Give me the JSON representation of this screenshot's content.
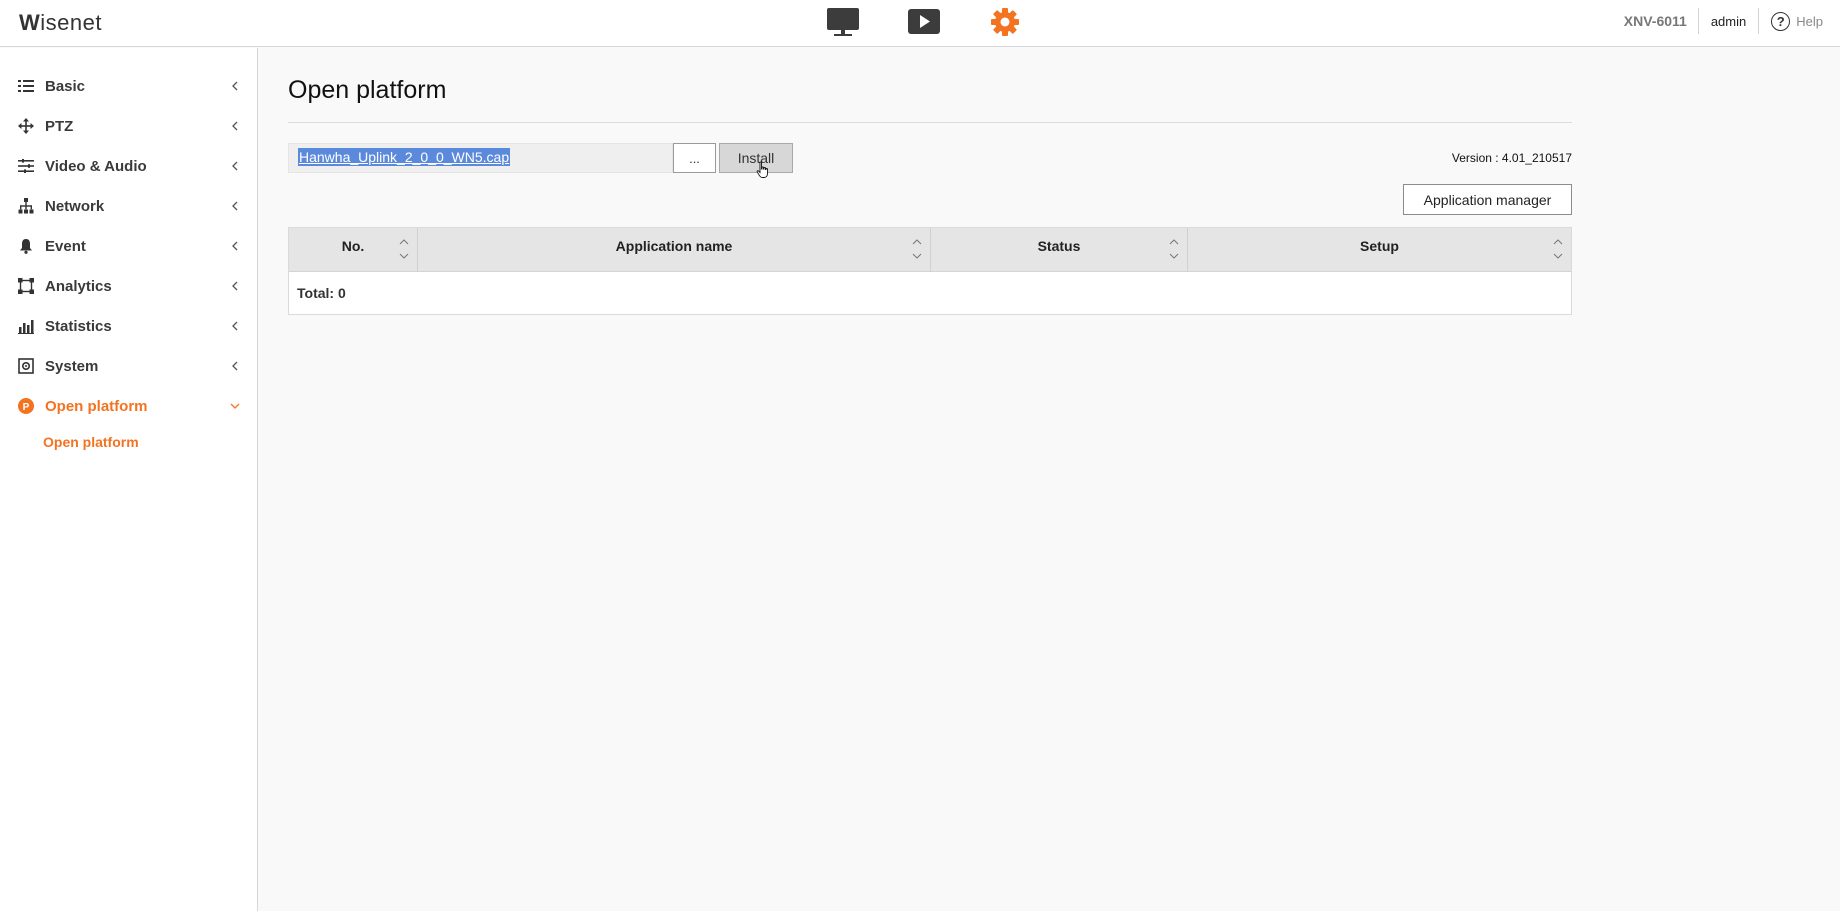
{
  "topbar": {
    "logo_prefix": "W",
    "logo_rest": "isenet",
    "nav_icons": [
      "monitor-icon",
      "playback-icon",
      "settings-icon"
    ],
    "model": "XNV-6011",
    "user": "admin",
    "help_label": "Help"
  },
  "sidebar": {
    "items": [
      {
        "label": "Basic",
        "icon": "list-icon"
      },
      {
        "label": "PTZ",
        "icon": "move-icon"
      },
      {
        "label": "Video & Audio",
        "icon": "sliders-icon"
      },
      {
        "label": "Network",
        "icon": "network-icon"
      },
      {
        "label": "Event",
        "icon": "bell-icon"
      },
      {
        "label": "Analytics",
        "icon": "analytics-icon"
      },
      {
        "label": "Statistics",
        "icon": "bar-chart-icon"
      },
      {
        "label": "System",
        "icon": "system-icon"
      },
      {
        "label": "Open platform",
        "icon": "open-platform-icon",
        "badge": "P"
      }
    ],
    "sub_items": [
      {
        "label": "Open platform"
      }
    ]
  },
  "main": {
    "title": "Open platform",
    "file_value": "Hanwha_Uplink_2_0_0_WN5.cap",
    "browse_label": "...",
    "install_label": "Install",
    "version_text": "Version : 4.01_210517",
    "app_manager_label": "Application manager",
    "table": {
      "columns": [
        "No.",
        "Application name",
        "Status",
        "Setup"
      ],
      "total_text": "Total: 0"
    }
  },
  "colors": {
    "accent": "#f37321",
    "selection": "#5b89dc"
  }
}
